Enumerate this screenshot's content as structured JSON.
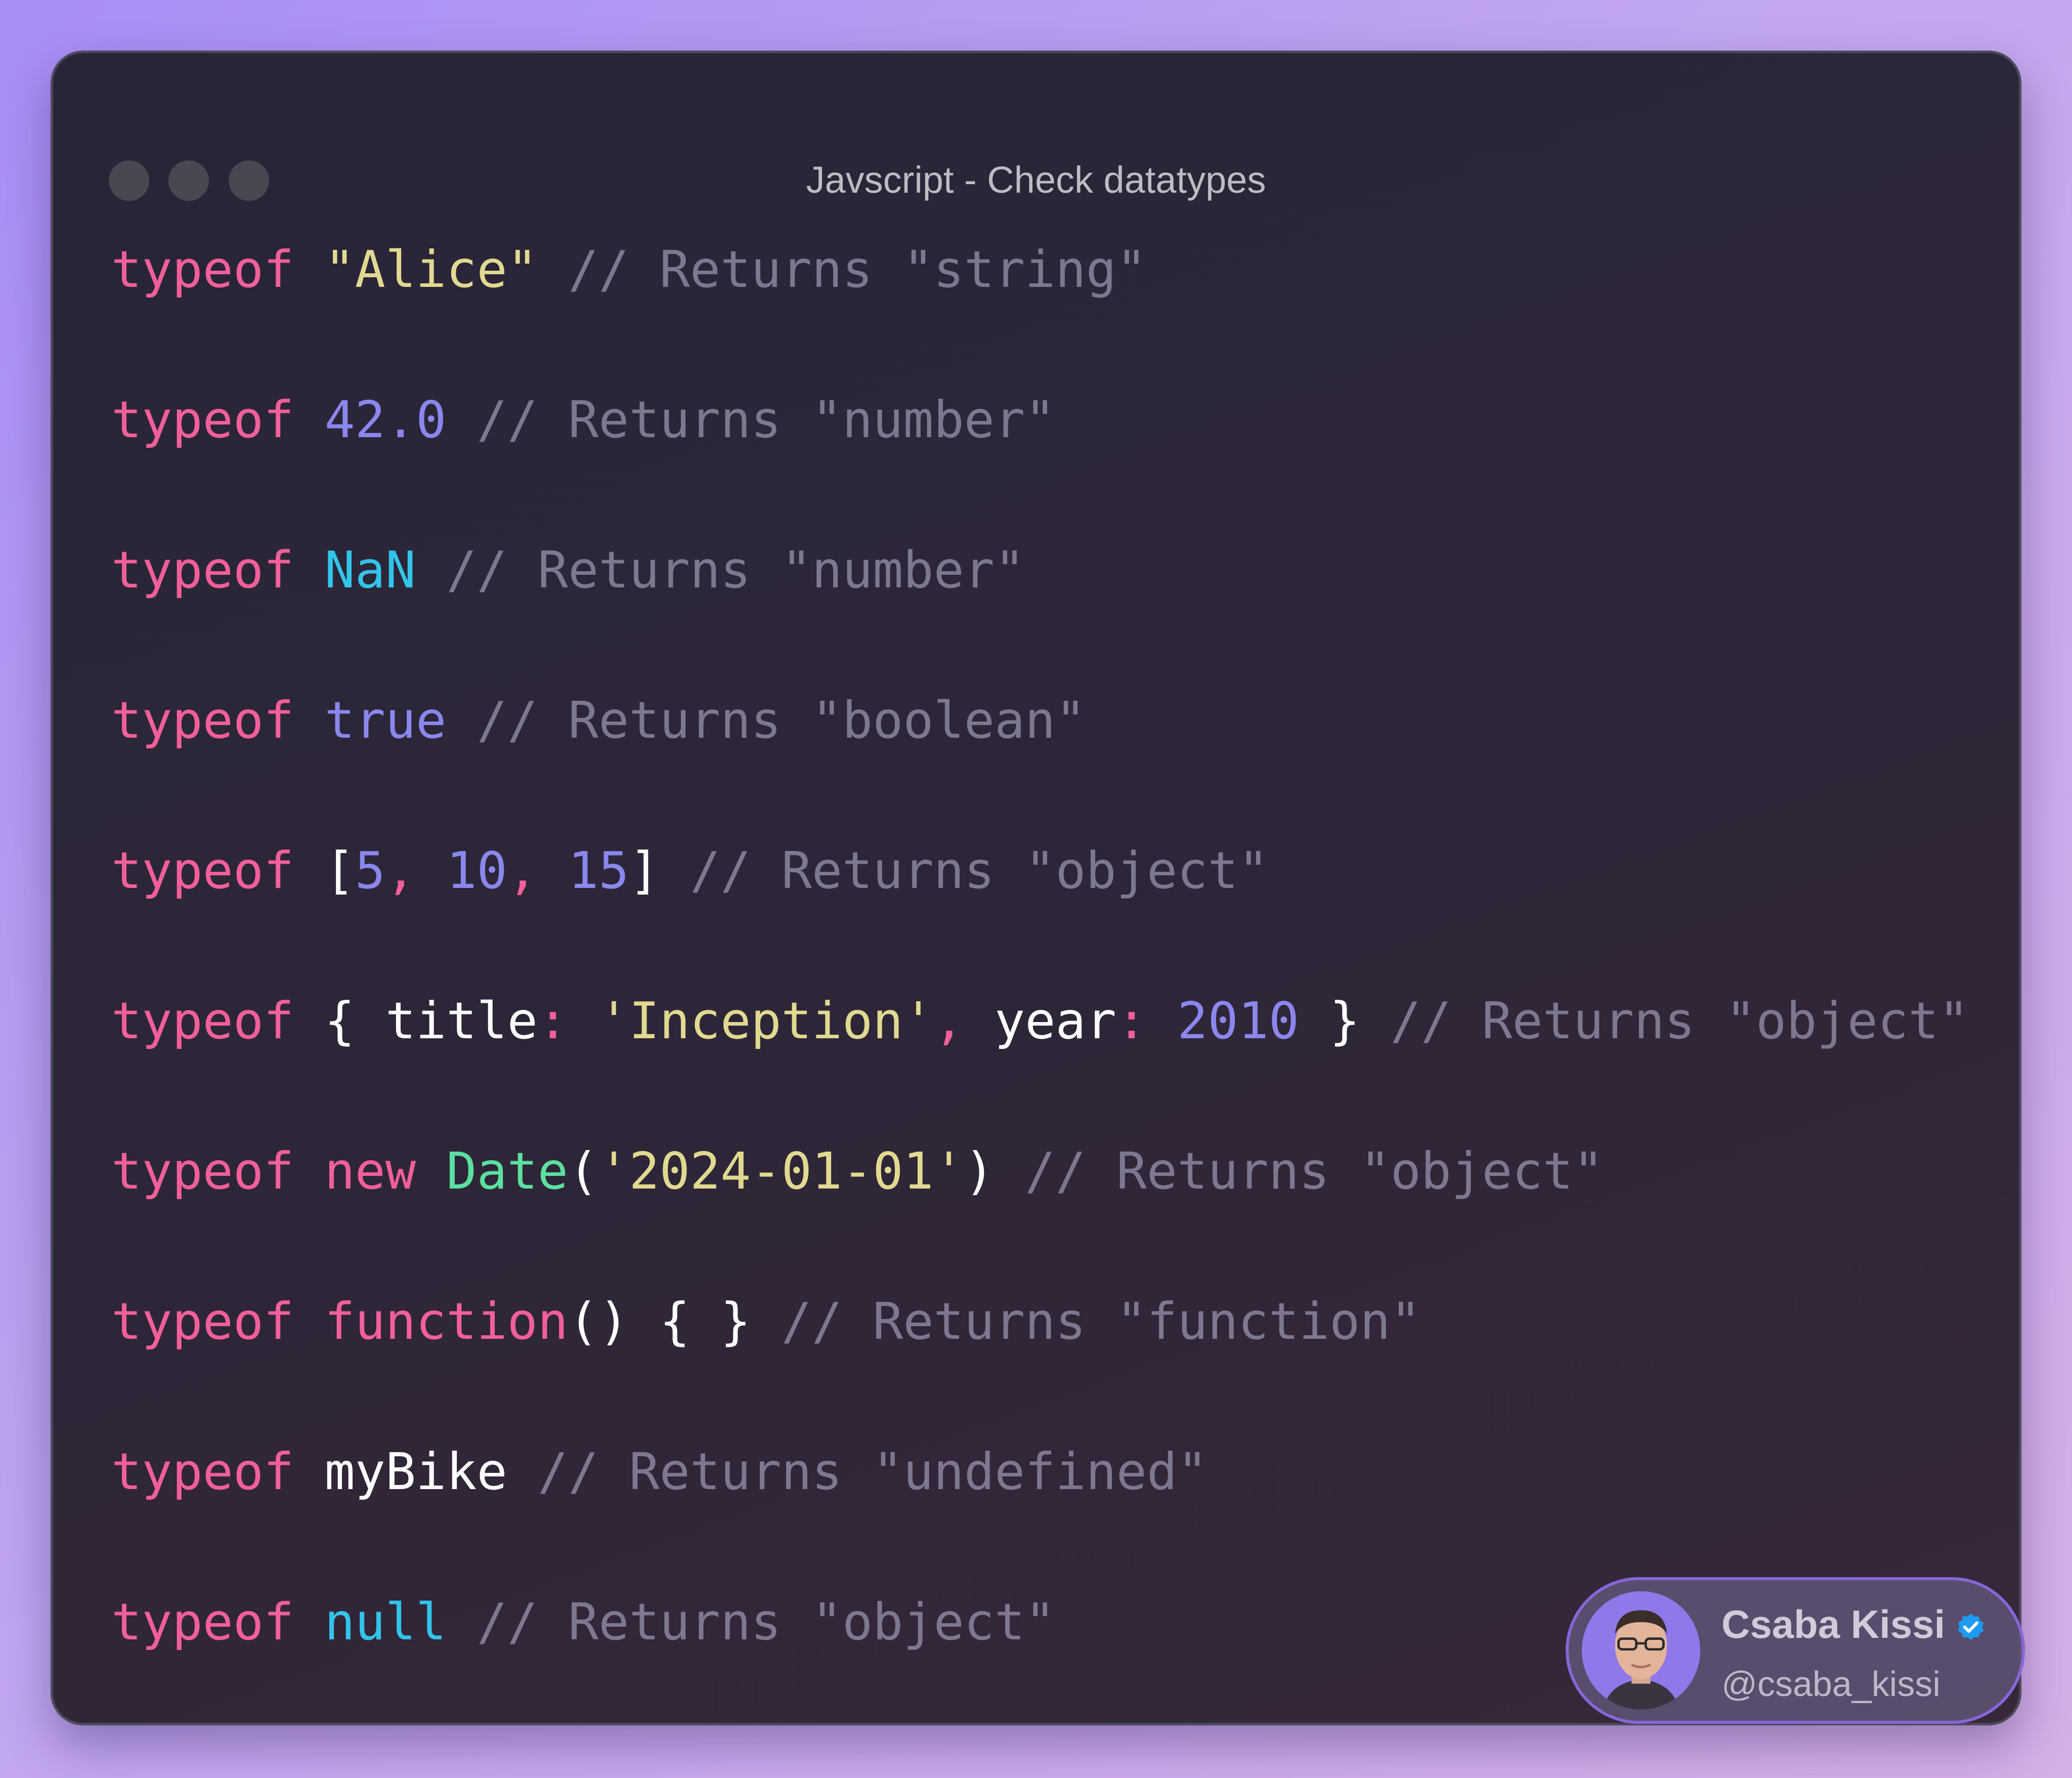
{
  "window": {
    "title": "Javscript - Check datatypes"
  },
  "code_lines": [
    [
      {
        "text": "typeof",
        "kind": "keyword"
      },
      {
        "text": " ",
        "kind": "plain"
      },
      {
        "text": "\"Alice\"",
        "kind": "string"
      },
      {
        "text": " // Returns \"string\"",
        "kind": "comment"
      }
    ],
    [
      {
        "text": "typeof",
        "kind": "keyword"
      },
      {
        "text": " ",
        "kind": "plain"
      },
      {
        "text": "42.0",
        "kind": "number"
      },
      {
        "text": " // Returns \"number\"",
        "kind": "comment"
      }
    ],
    [
      {
        "text": "typeof",
        "kind": "keyword"
      },
      {
        "text": " ",
        "kind": "plain"
      },
      {
        "text": "NaN",
        "kind": "const"
      },
      {
        "text": " // Returns \"number\"",
        "kind": "comment"
      }
    ],
    [
      {
        "text": "typeof",
        "kind": "keyword"
      },
      {
        "text": " ",
        "kind": "plain"
      },
      {
        "text": "true",
        "kind": "number"
      },
      {
        "text": " // Returns \"boolean\"",
        "kind": "comment"
      }
    ],
    [
      {
        "text": "typeof",
        "kind": "keyword"
      },
      {
        "text": " ",
        "kind": "plain"
      },
      {
        "text": "[",
        "kind": "plain"
      },
      {
        "text": "5",
        "kind": "number"
      },
      {
        "text": ", ",
        "kind": "punct"
      },
      {
        "text": "10",
        "kind": "number"
      },
      {
        "text": ", ",
        "kind": "punct"
      },
      {
        "text": "15",
        "kind": "number"
      },
      {
        "text": "]",
        "kind": "plain"
      },
      {
        "text": " // Returns \"object\"",
        "kind": "comment"
      }
    ],
    [
      {
        "text": "typeof",
        "kind": "keyword"
      },
      {
        "text": " ",
        "kind": "plain"
      },
      {
        "text": "{ title",
        "kind": "plain"
      },
      {
        "text": ": ",
        "kind": "punct"
      },
      {
        "text": "'Inception'",
        "kind": "string"
      },
      {
        "text": ", ",
        "kind": "punct"
      },
      {
        "text": "year",
        "kind": "plain"
      },
      {
        "text": ": ",
        "kind": "punct"
      },
      {
        "text": "2010",
        "kind": "number"
      },
      {
        "text": " }",
        "kind": "plain"
      },
      {
        "text": " // Returns \"object\"",
        "kind": "comment"
      }
    ],
    [
      {
        "text": "typeof",
        "kind": "keyword"
      },
      {
        "text": " ",
        "kind": "plain"
      },
      {
        "text": "new",
        "kind": "keyword"
      },
      {
        "text": " ",
        "kind": "plain"
      },
      {
        "text": "Date",
        "kind": "func"
      },
      {
        "text": "(",
        "kind": "plain"
      },
      {
        "text": "'2024-01-01'",
        "kind": "string"
      },
      {
        "text": ")",
        "kind": "plain"
      },
      {
        "text": " // Returns \"object\"",
        "kind": "comment"
      }
    ],
    [
      {
        "text": "typeof",
        "kind": "keyword"
      },
      {
        "text": " ",
        "kind": "plain"
      },
      {
        "text": "function",
        "kind": "keyword"
      },
      {
        "text": "() { }",
        "kind": "plain"
      },
      {
        "text": " // Returns \"function\"",
        "kind": "comment"
      }
    ],
    [
      {
        "text": "typeof",
        "kind": "keyword"
      },
      {
        "text": " ",
        "kind": "plain"
      },
      {
        "text": "myBike",
        "kind": "plain"
      },
      {
        "text": " // Returns \"undefined\"",
        "kind": "comment"
      }
    ],
    [
      {
        "text": "typeof",
        "kind": "keyword"
      },
      {
        "text": " ",
        "kind": "plain"
      },
      {
        "text": "null",
        "kind": "const"
      },
      {
        "text": " // Returns \"object\"",
        "kind": "comment"
      }
    ]
  ],
  "author_badge": {
    "name": "Csaba Kissi",
    "handle": "@csaba_kissi",
    "verified_icon": "verified-check-icon",
    "avatar_icon": "avatar-photo"
  },
  "colors": {
    "keyword": "#f25f9a",
    "string": "#e2d990",
    "number": "#8a87ee",
    "const": "#33c4ea",
    "func": "#5ce0a0",
    "comment": "#7d7890",
    "plain": "#ffffff",
    "verified": "#1d9bf0"
  }
}
